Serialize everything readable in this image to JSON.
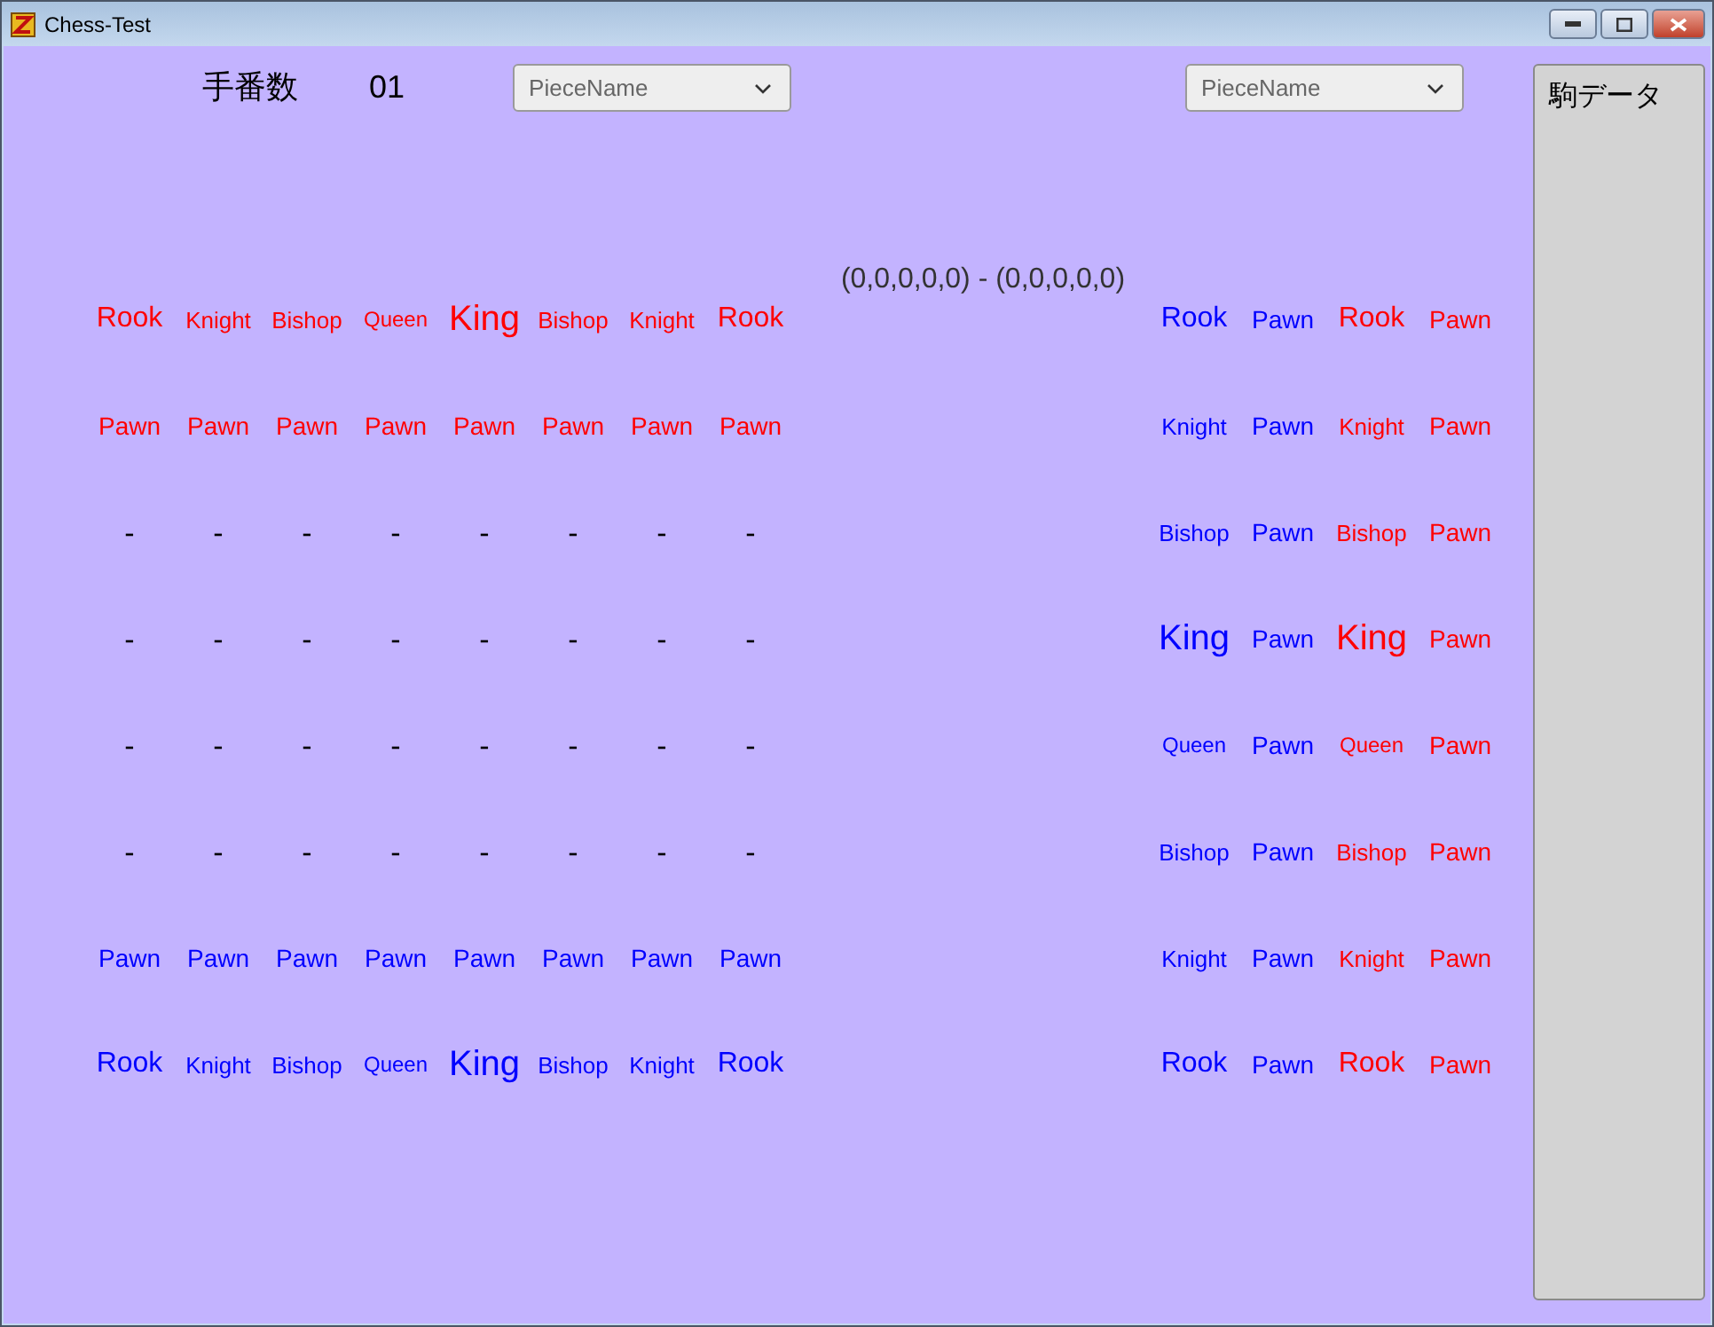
{
  "window": {
    "title": "Chess-Test"
  },
  "header": {
    "turn_label": "手番数",
    "turn_value": "01",
    "dropdowns": [
      {
        "placeholder": "PieceName"
      },
      {
        "placeholder": "PieceName"
      }
    ]
  },
  "board": {
    "rows": [
      [
        {
          "text": "Rook",
          "kind": "rook",
          "color": "#ff0000"
        },
        {
          "text": "Knight",
          "kind": "knight",
          "color": "#ff0000"
        },
        {
          "text": "Bishop",
          "kind": "bishop",
          "color": "#ff0000"
        },
        {
          "text": "Queen",
          "kind": "queen",
          "color": "#ff0000"
        },
        {
          "text": "King",
          "kind": "king",
          "color": "#ff0000"
        },
        {
          "text": "Bishop",
          "kind": "bishop",
          "color": "#ff0000"
        },
        {
          "text": "Knight",
          "kind": "knight",
          "color": "#ff0000"
        },
        {
          "text": "Rook",
          "kind": "rook",
          "color": "#ff0000"
        }
      ],
      [
        {
          "text": "Pawn",
          "kind": "pawn",
          "color": "#ff0000"
        },
        {
          "text": "Pawn",
          "kind": "pawn",
          "color": "#ff0000"
        },
        {
          "text": "Pawn",
          "kind": "pawn",
          "color": "#ff0000"
        },
        {
          "text": "Pawn",
          "kind": "pawn",
          "color": "#ff0000"
        },
        {
          "text": "Pawn",
          "kind": "pawn",
          "color": "#ff0000"
        },
        {
          "text": "Pawn",
          "kind": "pawn",
          "color": "#ff0000"
        },
        {
          "text": "Pawn",
          "kind": "pawn",
          "color": "#ff0000"
        },
        {
          "text": "Pawn",
          "kind": "pawn",
          "color": "#ff0000"
        }
      ],
      [
        {
          "text": "-",
          "kind": "empty",
          "color": "#000000"
        },
        {
          "text": "-",
          "kind": "empty",
          "color": "#000000"
        },
        {
          "text": "-",
          "kind": "empty",
          "color": "#000000"
        },
        {
          "text": "-",
          "kind": "empty",
          "color": "#000000"
        },
        {
          "text": "-",
          "kind": "empty",
          "color": "#000000"
        },
        {
          "text": "-",
          "kind": "empty",
          "color": "#000000"
        },
        {
          "text": "-",
          "kind": "empty",
          "color": "#000000"
        },
        {
          "text": "-",
          "kind": "empty",
          "color": "#000000"
        }
      ],
      [
        {
          "text": "-",
          "kind": "empty",
          "color": "#000000"
        },
        {
          "text": "-",
          "kind": "empty",
          "color": "#000000"
        },
        {
          "text": "-",
          "kind": "empty",
          "color": "#000000"
        },
        {
          "text": "-",
          "kind": "empty",
          "color": "#000000"
        },
        {
          "text": "-",
          "kind": "empty",
          "color": "#000000"
        },
        {
          "text": "-",
          "kind": "empty",
          "color": "#000000"
        },
        {
          "text": "-",
          "kind": "empty",
          "color": "#000000"
        },
        {
          "text": "-",
          "kind": "empty",
          "color": "#000000"
        }
      ],
      [
        {
          "text": "-",
          "kind": "empty",
          "color": "#000000"
        },
        {
          "text": "-",
          "kind": "empty",
          "color": "#000000"
        },
        {
          "text": "-",
          "kind": "empty",
          "color": "#000000"
        },
        {
          "text": "-",
          "kind": "empty",
          "color": "#000000"
        },
        {
          "text": "-",
          "kind": "empty",
          "color": "#000000"
        },
        {
          "text": "-",
          "kind": "empty",
          "color": "#000000"
        },
        {
          "text": "-",
          "kind": "empty",
          "color": "#000000"
        },
        {
          "text": "-",
          "kind": "empty",
          "color": "#000000"
        }
      ],
      [
        {
          "text": "-",
          "kind": "empty",
          "color": "#000000"
        },
        {
          "text": "-",
          "kind": "empty",
          "color": "#000000"
        },
        {
          "text": "-",
          "kind": "empty",
          "color": "#000000"
        },
        {
          "text": "-",
          "kind": "empty",
          "color": "#000000"
        },
        {
          "text": "-",
          "kind": "empty",
          "color": "#000000"
        },
        {
          "text": "-",
          "kind": "empty",
          "color": "#000000"
        },
        {
          "text": "-",
          "kind": "empty",
          "color": "#000000"
        },
        {
          "text": "-",
          "kind": "empty",
          "color": "#000000"
        }
      ],
      [
        {
          "text": "Pawn",
          "kind": "pawn",
          "color": "#0000ff"
        },
        {
          "text": "Pawn",
          "kind": "pawn",
          "color": "#0000ff"
        },
        {
          "text": "Pawn",
          "kind": "pawn",
          "color": "#0000ff"
        },
        {
          "text": "Pawn",
          "kind": "pawn",
          "color": "#0000ff"
        },
        {
          "text": "Pawn",
          "kind": "pawn",
          "color": "#0000ff"
        },
        {
          "text": "Pawn",
          "kind": "pawn",
          "color": "#0000ff"
        },
        {
          "text": "Pawn",
          "kind": "pawn",
          "color": "#0000ff"
        },
        {
          "text": "Pawn",
          "kind": "pawn",
          "color": "#0000ff"
        }
      ],
      [
        {
          "text": "Rook",
          "kind": "rook",
          "color": "#0000ff"
        },
        {
          "text": "Knight",
          "kind": "knight",
          "color": "#0000ff"
        },
        {
          "text": "Bishop",
          "kind": "bishop",
          "color": "#0000ff"
        },
        {
          "text": "Queen",
          "kind": "queen",
          "color": "#0000ff"
        },
        {
          "text": "King",
          "kind": "king",
          "color": "#0000ff"
        },
        {
          "text": "Bishop",
          "kind": "bishop",
          "color": "#0000ff"
        },
        {
          "text": "Knight",
          "kind": "knight",
          "color": "#0000ff"
        },
        {
          "text": "Rook",
          "kind": "rook",
          "color": "#0000ff"
        }
      ]
    ]
  },
  "score": "(0,0,0,0,0) - (0,0,0,0,0)",
  "pieces": {
    "rows": [
      [
        {
          "text": "Rook",
          "kind": "rook",
          "color": "#0000ff"
        },
        {
          "text": "Pawn",
          "kind": "pawn",
          "color": "#0000ff"
        },
        {
          "text": "Rook",
          "kind": "rook",
          "color": "#ff0000"
        },
        {
          "text": "Pawn",
          "kind": "pawn",
          "color": "#ff0000"
        }
      ],
      [
        {
          "text": "Knight",
          "kind": "knight",
          "color": "#0000ff"
        },
        {
          "text": "Pawn",
          "kind": "pawn",
          "color": "#0000ff"
        },
        {
          "text": "Knight",
          "kind": "knight",
          "color": "#ff0000"
        },
        {
          "text": "Pawn",
          "kind": "pawn",
          "color": "#ff0000"
        }
      ],
      [
        {
          "text": "Bishop",
          "kind": "bishop",
          "color": "#0000ff"
        },
        {
          "text": "Pawn",
          "kind": "pawn",
          "color": "#0000ff"
        },
        {
          "text": "Bishop",
          "kind": "bishop",
          "color": "#ff0000"
        },
        {
          "text": "Pawn",
          "kind": "pawn",
          "color": "#ff0000"
        }
      ],
      [
        {
          "text": "King",
          "kind": "king",
          "color": "#0000ff"
        },
        {
          "text": "Pawn",
          "kind": "pawn",
          "color": "#0000ff"
        },
        {
          "text": "King",
          "kind": "king",
          "color": "#ff0000"
        },
        {
          "text": "Pawn",
          "kind": "pawn",
          "color": "#ff0000"
        }
      ],
      [
        {
          "text": "Queen",
          "kind": "queen",
          "color": "#0000ff"
        },
        {
          "text": "Pawn",
          "kind": "pawn",
          "color": "#0000ff"
        },
        {
          "text": "Queen",
          "kind": "queen",
          "color": "#ff0000"
        },
        {
          "text": "Pawn",
          "kind": "pawn",
          "color": "#ff0000"
        }
      ],
      [
        {
          "text": "Bishop",
          "kind": "bishop",
          "color": "#0000ff"
        },
        {
          "text": "Pawn",
          "kind": "pawn",
          "color": "#0000ff"
        },
        {
          "text": "Bishop",
          "kind": "bishop",
          "color": "#ff0000"
        },
        {
          "text": "Pawn",
          "kind": "pawn",
          "color": "#ff0000"
        }
      ],
      [
        {
          "text": "Knight",
          "kind": "knight",
          "color": "#0000ff"
        },
        {
          "text": "Pawn",
          "kind": "pawn",
          "color": "#0000ff"
        },
        {
          "text": "Knight",
          "kind": "knight",
          "color": "#ff0000"
        },
        {
          "text": "Pawn",
          "kind": "pawn",
          "color": "#ff0000"
        }
      ],
      [
        {
          "text": "Rook",
          "kind": "rook",
          "color": "#0000ff"
        },
        {
          "text": "Pawn",
          "kind": "pawn",
          "color": "#0000ff"
        },
        {
          "text": "Rook",
          "kind": "rook",
          "color": "#ff0000"
        },
        {
          "text": "Pawn",
          "kind": "pawn",
          "color": "#ff0000"
        }
      ]
    ]
  },
  "side_panel": {
    "title": "駒データ"
  }
}
